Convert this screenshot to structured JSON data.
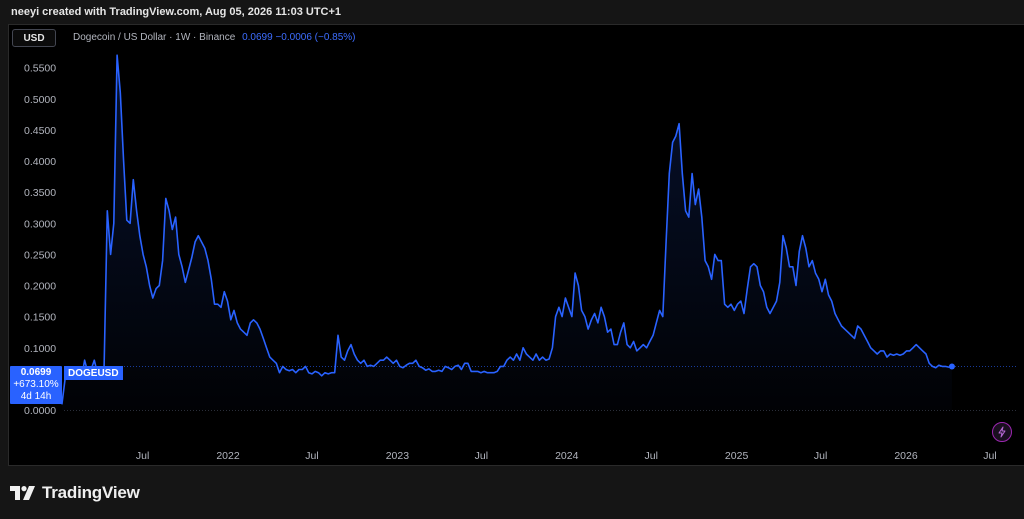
{
  "caption": "neeyi created with TradingView.com, Aug 05, 2026 11:03 UTC+1",
  "toolbar": {
    "currency": "USD"
  },
  "symbol": {
    "description": "Dogecoin / US Dollar · 1W · Binance",
    "price": "0.0699",
    "change": "−0.0006 (−0.85%)"
  },
  "badge": {
    "price": "0.0699",
    "pct": "+673.10%",
    "countdown": "4d 14h",
    "ticker": "DOGEUSD"
  },
  "brand": {
    "name": "TradingView",
    "icon": "tradingview-logo-icon"
  },
  "icons": {
    "bolt": "lightning-bolt-icon"
  },
  "colors": {
    "line": "#2962ff",
    "badge": "#2962ff",
    "bolt": "#9c27b0",
    "background": "#000000"
  },
  "chart_data": {
    "type": "area",
    "symbol": "DOGEUSD",
    "interval": "1W",
    "y_ticks": [
      "0.5500",
      "0.5000",
      "0.4500",
      "0.4000",
      "0.3500",
      "0.3000",
      "0.2500",
      "0.2000",
      "0.1500",
      "0.1000",
      "0.0500",
      "0.0000"
    ],
    "x_ticks": [
      "Jul",
      "2022",
      "Jul",
      "2023",
      "Jul",
      "2024",
      "Jul",
      "2025",
      "Jul",
      "2026",
      "Jul"
    ],
    "ylim": [
      0,
      0.58
    ],
    "grid": false,
    "x_start": "2021-01-08",
    "x_step_days": 7,
    "values": [
      0.009,
      0.05,
      0.06,
      0.05,
      0.055,
      0.06,
      0.05,
      0.08,
      0.06,
      0.065,
      0.08,
      0.058,
      0.065,
      0.07,
      0.32,
      0.25,
      0.3,
      0.57,
      0.51,
      0.4,
      0.305,
      0.3,
      0.37,
      0.32,
      0.28,
      0.25,
      0.23,
      0.2,
      0.18,
      0.195,
      0.2,
      0.24,
      0.34,
      0.32,
      0.29,
      0.31,
      0.25,
      0.23,
      0.205,
      0.225,
      0.245,
      0.27,
      0.28,
      0.27,
      0.26,
      0.24,
      0.21,
      0.17,
      0.17,
      0.165,
      0.19,
      0.175,
      0.145,
      0.16,
      0.14,
      0.13,
      0.125,
      0.12,
      0.14,
      0.145,
      0.14,
      0.13,
      0.115,
      0.1,
      0.085,
      0.08,
      0.075,
      0.06,
      0.07,
      0.065,
      0.063,
      0.065,
      0.06,
      0.065,
      0.065,
      0.07,
      0.06,
      0.058,
      0.062,
      0.06,
      0.055,
      0.06,
      0.058,
      0.06,
      0.06,
      0.12,
      0.085,
      0.08,
      0.095,
      0.105,
      0.09,
      0.08,
      0.075,
      0.08,
      0.07,
      0.072,
      0.07,
      0.075,
      0.08,
      0.08,
      0.085,
      0.08,
      0.075,
      0.08,
      0.07,
      0.068,
      0.072,
      0.075,
      0.075,
      0.08,
      0.07,
      0.068,
      0.064,
      0.066,
      0.062,
      0.062,
      0.064,
      0.062,
      0.07,
      0.068,
      0.065,
      0.07,
      0.072,
      0.065,
      0.075,
      0.075,
      0.062,
      0.062,
      0.062,
      0.06,
      0.062,
      0.06,
      0.06,
      0.06,
      0.062,
      0.07,
      0.07,
      0.08,
      0.085,
      0.08,
      0.09,
      0.08,
      0.1,
      0.09,
      0.085,
      0.08,
      0.09,
      0.08,
      0.085,
      0.08,
      0.082,
      0.1,
      0.15,
      0.165,
      0.15,
      0.18,
      0.165,
      0.15,
      0.22,
      0.2,
      0.16,
      0.15,
      0.13,
      0.145,
      0.155,
      0.14,
      0.165,
      0.15,
      0.125,
      0.13,
      0.105,
      0.105,
      0.125,
      0.14,
      0.105,
      0.1,
      0.11,
      0.095,
      0.1,
      0.105,
      0.1,
      0.11,
      0.12,
      0.14,
      0.16,
      0.15,
      0.27,
      0.38,
      0.43,
      0.44,
      0.46,
      0.38,
      0.32,
      0.31,
      0.38,
      0.33,
      0.355,
      0.31,
      0.24,
      0.23,
      0.21,
      0.25,
      0.24,
      0.24,
      0.17,
      0.165,
      0.17,
      0.16,
      0.17,
      0.175,
      0.155,
      0.195,
      0.23,
      0.235,
      0.23,
      0.2,
      0.19,
      0.165,
      0.155,
      0.165,
      0.175,
      0.205,
      0.28,
      0.26,
      0.23,
      0.23,
      0.2,
      0.255,
      0.28,
      0.26,
      0.23,
      0.24,
      0.22,
      0.21,
      0.19,
      0.21,
      0.185,
      0.175,
      0.155,
      0.145,
      0.135,
      0.13,
      0.125,
      0.12,
      0.115,
      0.135,
      0.13,
      0.12,
      0.11,
      0.1,
      0.095,
      0.09,
      0.095,
      0.095,
      0.085,
      0.09,
      0.088,
      0.09,
      0.088,
      0.09,
      0.095,
      0.095,
      0.1,
      0.105,
      0.1,
      0.095,
      0.09,
      0.075,
      0.07,
      0.068,
      0.072,
      0.07,
      0.07,
      0.069,
      0.0699
    ]
  }
}
